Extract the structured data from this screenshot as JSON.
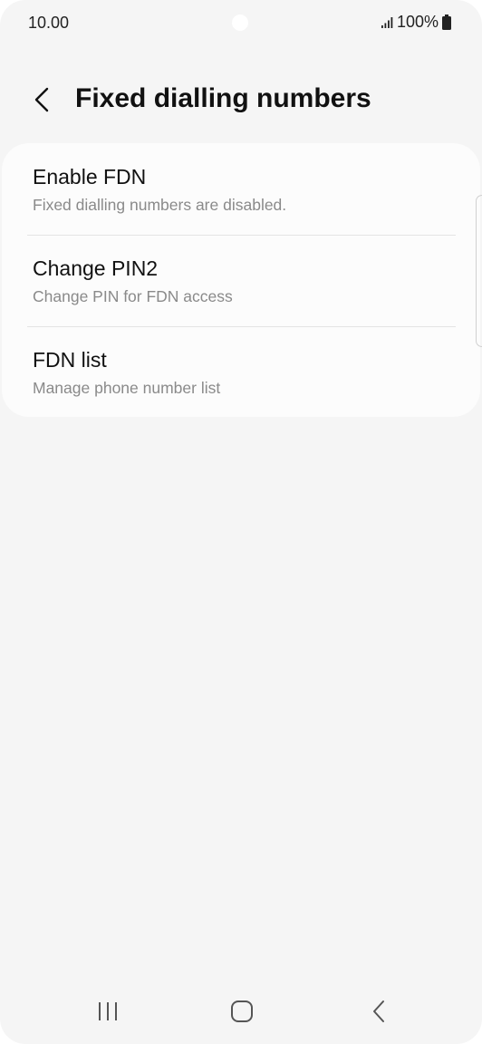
{
  "status_bar": {
    "time": "10.00",
    "battery_text": "100%"
  },
  "header": {
    "title": "Fixed dialling numbers"
  },
  "settings": {
    "items": [
      {
        "title": "Enable FDN",
        "subtitle": "Fixed dialling numbers are disabled."
      },
      {
        "title": "Change PIN2",
        "subtitle": "Change PIN for FDN access"
      },
      {
        "title": "FDN list",
        "subtitle": "Manage phone number list"
      }
    ]
  },
  "icons": {
    "back": "chevron-left-icon",
    "signal": "signal-icon",
    "battery": "battery-icon",
    "nav_recent": "recent-apps-icon",
    "nav_home": "home-icon",
    "nav_back": "back-icon"
  },
  "colors": {
    "background": "#f5f5f5",
    "card": "#fcfcfc",
    "subtitle_text": "#8a8a8a"
  }
}
